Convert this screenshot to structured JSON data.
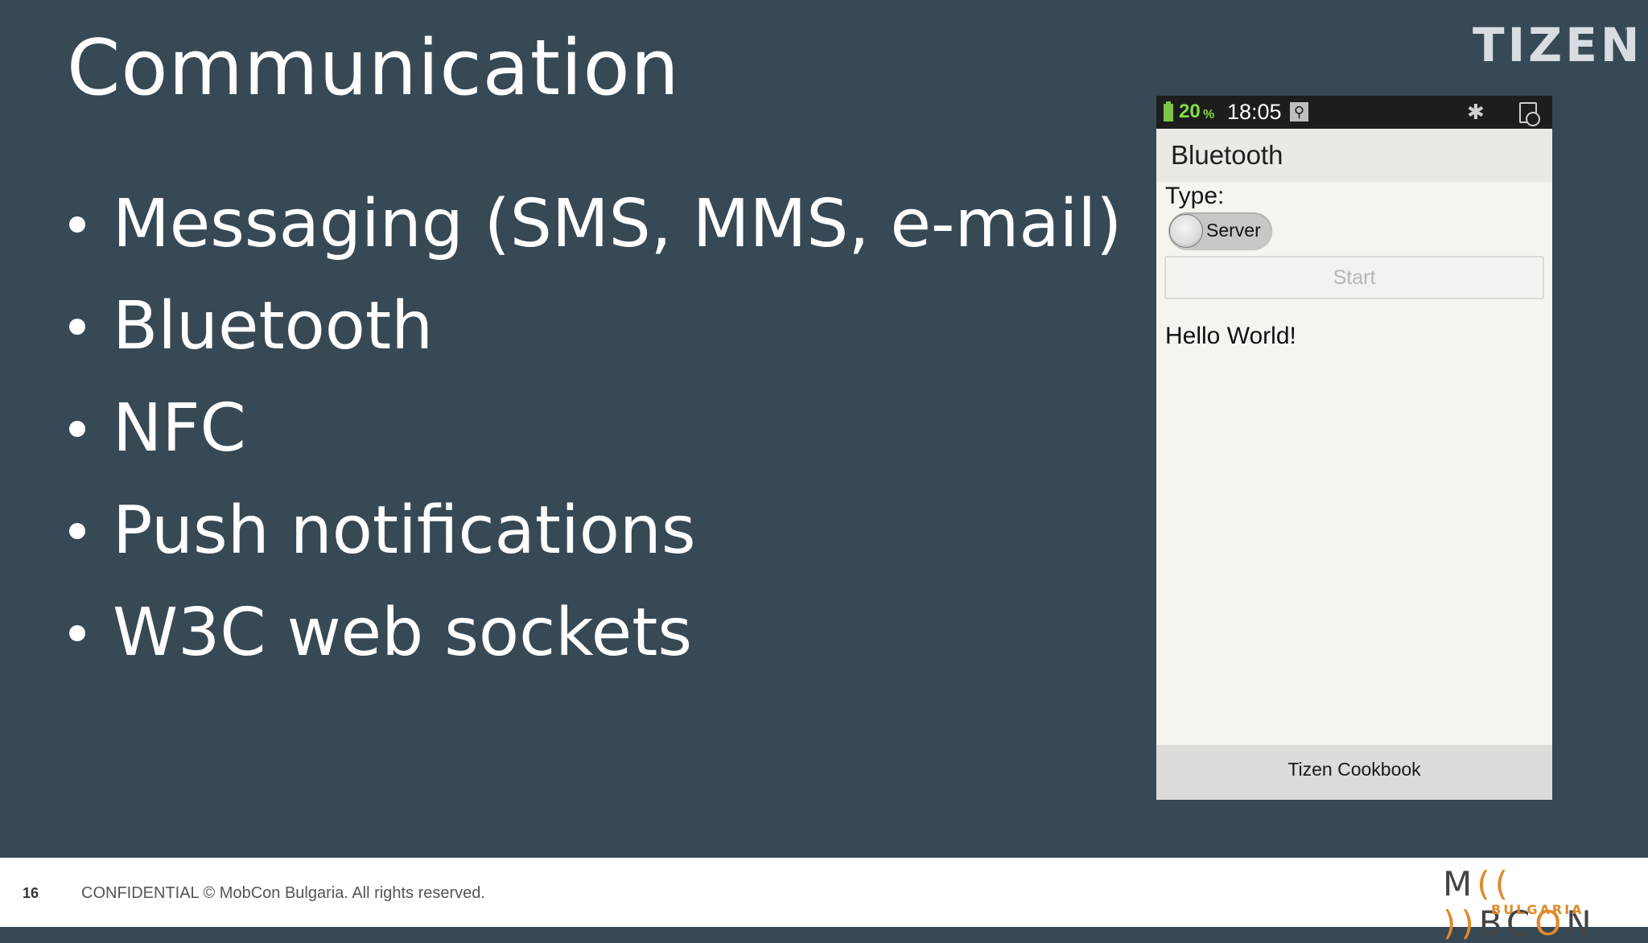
{
  "slide": {
    "title": "Communication",
    "bullets": [
      "Messaging (SMS, MMS, e-mail)",
      "Bluetooth",
      "NFC",
      "Push notifications",
      "W3C web sockets"
    ],
    "brand": "TIZEN",
    "brand_mark": "™"
  },
  "phone": {
    "status": {
      "battery_percent": "20",
      "battery_unit": "%",
      "time": "18:05",
      "icons": [
        "battery-icon",
        "usb-icon",
        "bluetooth-icon",
        "sd-card-icon"
      ]
    },
    "app_title": "Bluetooth",
    "type_label": "Type:",
    "toggle_label": "Server",
    "start_label": "Start",
    "message": "Hello World!",
    "footer": "Tizen Cookbook"
  },
  "footer": {
    "page_number": "16",
    "confidential": "CONFIDENTIAL © MobCon Bulgaria. All rights reserved.",
    "logo_left": "M",
    "logo_signal": "(( ))",
    "logo_mid": "BC",
    "logo_signal2": "O",
    "logo_right": "N",
    "logo_sub": "BULGARIA"
  },
  "colors": {
    "background": "#374955",
    "accent": "#e08a2b",
    "battery": "#7fe03e"
  }
}
